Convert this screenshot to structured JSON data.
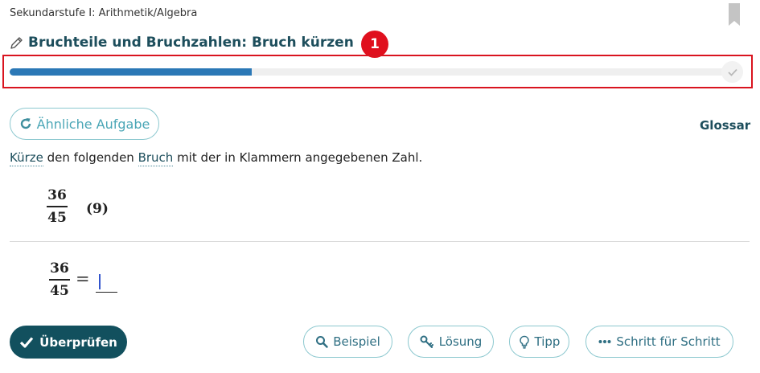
{
  "breadcrumb": "Sekundarstufe I: Arithmetik/Algebra",
  "title": "Bruchteile und Bruchzahlen: Bruch kürzen",
  "badge": "1",
  "progress": {
    "fraction": 0.33
  },
  "buttons": {
    "similar": "Ähnliche Aufgabe",
    "glossar": "Glossar",
    "check": "Überprüfen",
    "example": "Beispiel",
    "solution": "Lösung",
    "tip": "Tipp",
    "step_by_step": "Schritt für Schritt"
  },
  "instruction": {
    "word1": "Kürze",
    "text1": " den folgenden ",
    "word2": "Bruch",
    "text2": " mit der in Klammern angegebenen Zahl."
  },
  "task": {
    "numerator": "36",
    "denominator": "45",
    "factor": "(9)"
  },
  "answer": {
    "numerator": "36",
    "denominator": "45",
    "equals": "=",
    "value": ""
  },
  "colors": {
    "primary": "#12505e",
    "accent": "#4aa6b6",
    "progress": "#2b78b6",
    "highlight": "#d9141f"
  },
  "icons": {
    "bookmark": "bookmark-icon",
    "title": "pencil-icon",
    "similar": "refresh-icon",
    "check": "checkmark-icon",
    "example": "magnifier-icon",
    "solution": "key-icon",
    "tip": "lightbulb-icon",
    "step_by_step": "ellipsis-icon",
    "progress_end": "checkmark-icon"
  }
}
